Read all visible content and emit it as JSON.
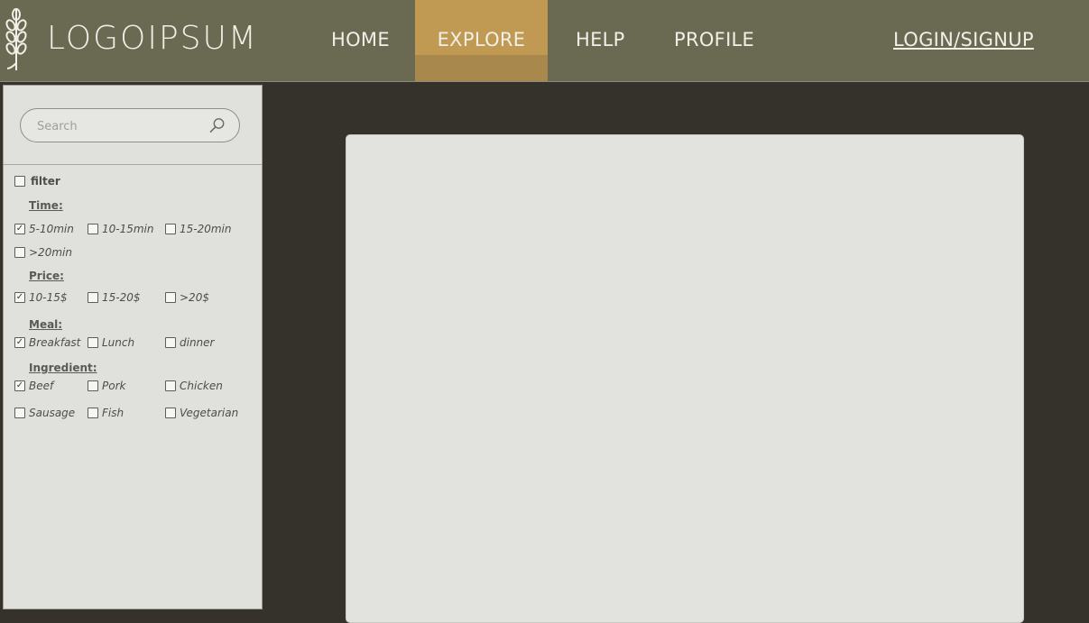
{
  "header": {
    "logo_text": "LOGOIPSUM",
    "nav": {
      "home": "HOME",
      "explore": "EXPLORE",
      "help": "HELP",
      "profile": "PROFILE",
      "login": "LOGIN/SIGNUP"
    },
    "active_nav": "EXPLORE"
  },
  "sidebar": {
    "search": {
      "placeholder": "Search",
      "value": ""
    },
    "filter": {
      "label": "filter",
      "checked": false
    },
    "groups": {
      "time": {
        "label": "Time:",
        "options": [
          {
            "label": "5-10min",
            "checked": true
          },
          {
            "label": "10-15min",
            "checked": false
          },
          {
            "label": "15-20min",
            "checked": false
          },
          {
            "label": ">20min",
            "checked": false
          }
        ]
      },
      "price": {
        "label": "Price:",
        "options": [
          {
            "label": "10-15$",
            "checked": true
          },
          {
            "label": "15-20$",
            "checked": false
          },
          {
            "label": ">20$",
            "checked": false
          }
        ]
      },
      "meal": {
        "label": "Meal:",
        "options": [
          {
            "label": "Breakfast",
            "checked": true
          },
          {
            "label": "Lunch",
            "checked": false
          },
          {
            "label": "dinner",
            "checked": false
          }
        ]
      },
      "ingredient": {
        "label": "Ingredient:",
        "options": [
          {
            "label": "Beef",
            "checked": true
          },
          {
            "label": "Pork",
            "checked": false
          },
          {
            "label": "Chicken",
            "checked": false
          },
          {
            "label": "Sausage",
            "checked": false
          },
          {
            "label": "Fish",
            "checked": false
          },
          {
            "label": "Vegetarian",
            "checked": false
          }
        ]
      }
    }
  },
  "colors": {
    "header_bg": "#6a6a52",
    "nav_active": "#c09a52",
    "page_bg": "#35312b",
    "panel_bg": "#e0e0dc"
  },
  "icons": {
    "logo": "wheat-icon",
    "search": "search-icon"
  }
}
